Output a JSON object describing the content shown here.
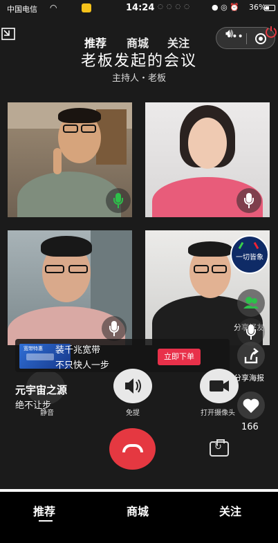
{
  "status_bar": {
    "carrier": "中国电信",
    "time": "14:24",
    "battery": "36%"
  },
  "top_tabs": [
    "推荐",
    "商城",
    "关注"
  ],
  "meeting": {
    "title": "老板发起的会议",
    "host_line": "主持人・老板"
  },
  "promo_avatar_text": "一切皆象",
  "side_actions": {
    "share_friend": "分享好友",
    "share_poster": "分享海报",
    "like_count": "166"
  },
  "ad": {
    "line1": "装千兆宽带",
    "line2": "不只快人一步",
    "cta": "立即下单",
    "thumb_top": "宽带特惠"
  },
  "caption": {
    "title": "元宇宙之源",
    "subtitle": "绝不让步"
  },
  "controls": {
    "mute": "静音",
    "speaker": "免提",
    "camera": "打开摄像头"
  },
  "bottom_nav": [
    "推荐",
    "商城",
    "关注"
  ],
  "colors": {
    "hangup": "#e53841",
    "active_mic": "#2dc04a",
    "cta": "#e8314a"
  }
}
